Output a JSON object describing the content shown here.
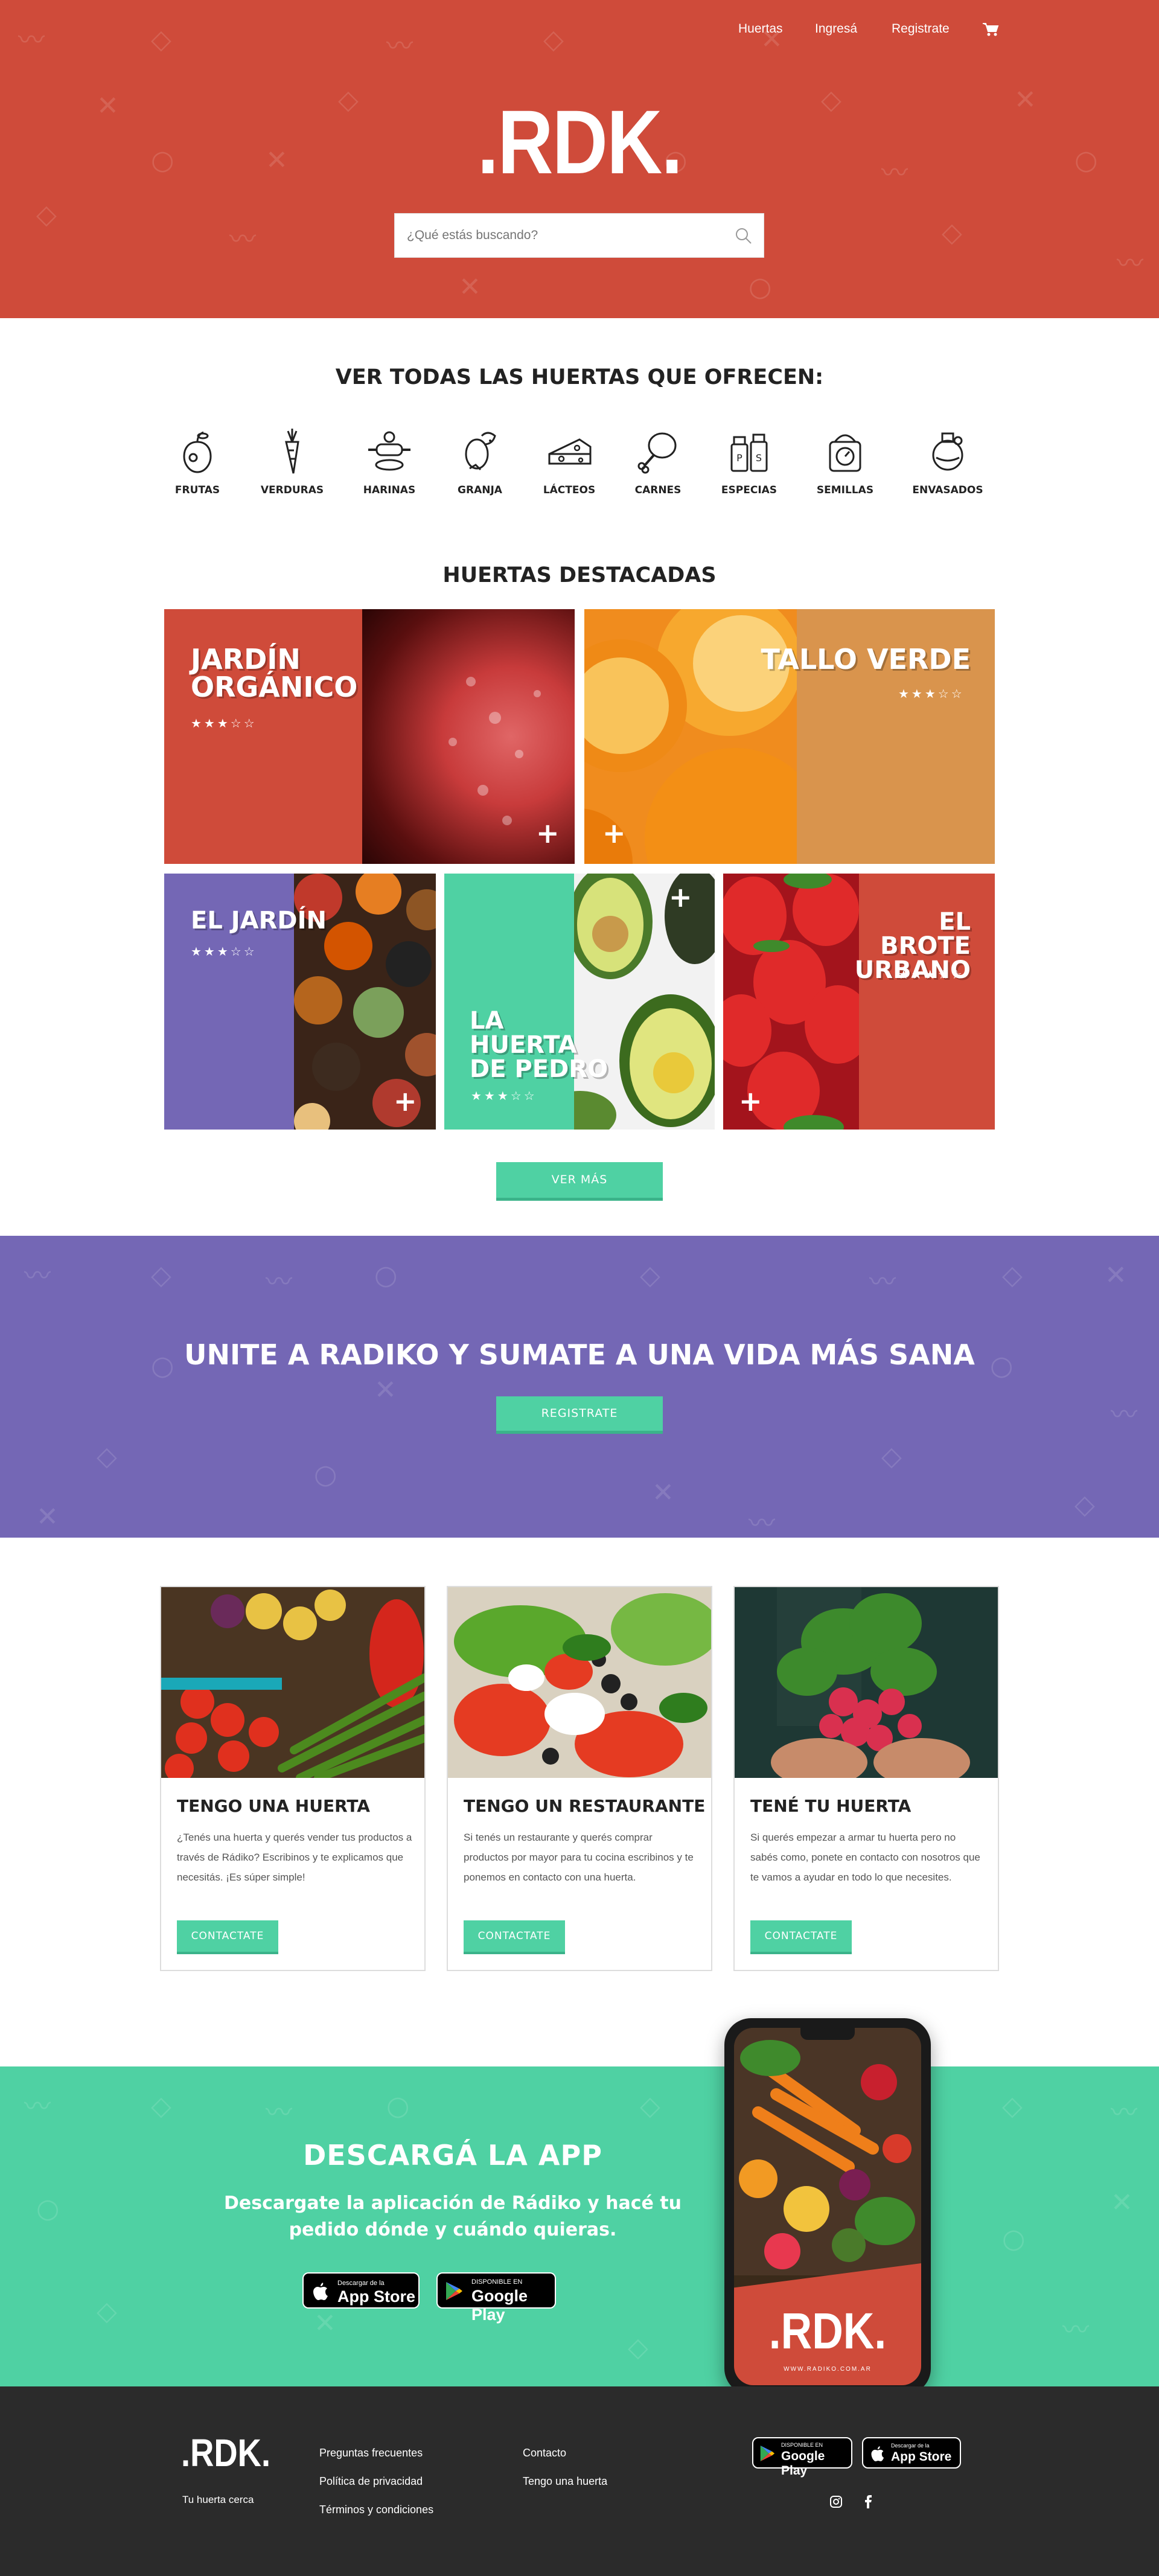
{
  "nav": {
    "huertas": "Huertas",
    "ingresa": "Ingresá",
    "registrate": "Registrate"
  },
  "brand": {
    "logo": ".RDK.",
    "tagline": "Tu huerta cerca",
    "phone_url": "WWW.RADIKO.COM.AR"
  },
  "search": {
    "placeholder": "¿Qué estás buscando?"
  },
  "categories": {
    "title": "VER TODAS LAS HUERTAS QUE OFRECEN:",
    "items": [
      {
        "label": "FRUTAS",
        "icon": "apple-icon"
      },
      {
        "label": "VERDURAS",
        "icon": "carrot-icon"
      },
      {
        "label": "HARINAS",
        "icon": "rolling-pin-icon"
      },
      {
        "label": "GRANJA",
        "icon": "egg-icon"
      },
      {
        "label": "LÁCTEOS",
        "icon": "cheese-icon"
      },
      {
        "label": "CARNES",
        "icon": "chicken-leg-icon"
      },
      {
        "label": "ESPECIAS",
        "icon": "salt-pepper-icon"
      },
      {
        "label": "SEMILLAS",
        "icon": "scale-icon"
      },
      {
        "label": "ENVASADOS",
        "icon": "jar-icon"
      }
    ]
  },
  "featured": {
    "title": "HUERTAS DESTACADAS",
    "tiles": [
      {
        "name": "JARDÍN\nORGÁNICO",
        "stars": "★★★☆☆",
        "color": "#cf4b3a"
      },
      {
        "name": "TALLO VERDE",
        "stars": "★★★☆☆",
        "color": "#d9944d"
      },
      {
        "name": "EL JARDÍN",
        "stars": "★★★☆☆",
        "color": "#7467b5"
      },
      {
        "name": "LA\nHUERTA\nDE PEDRO",
        "stars": "★★★☆☆",
        "color": "#4fd1a3"
      },
      {
        "name": "EL BROTE\nURBANO",
        "stars": "★★★☆☆",
        "color": "#cf4b3a"
      }
    ],
    "more": "VER MÁS"
  },
  "join": {
    "title": "UNITE A RADIKO Y SUMATE A UNA VIDA MÁS SANA",
    "button": "REGISTRATE"
  },
  "cards": [
    {
      "title": "TENGO UNA HUERTA",
      "desc": "¿Tenés una huerta y querés vender tus productos a través de Rádiko? Escribinos y te explicamos que necesitás. ¡Es súper simple!",
      "button": "CONTACTATE"
    },
    {
      "title": "TENGO UN RESTAURANTE",
      "desc": "Si tenés un restaurante y querés comprar productos por mayor para tu cocina escribinos y te ponemos en contacto con una huerta.",
      "button": "CONTACTATE"
    },
    {
      "title": "TENÉ TU HUERTA",
      "desc": "Si querés empezar a armar tu huerta pero no sabés como, ponete en contacto con nosotros que te vamos a ayudar en todo lo que necesites.",
      "button": "CONTACTATE"
    }
  ],
  "app": {
    "title": "DESCARGÁ LA APP",
    "subtitle": "Descargate la aplicación de Rádiko y hacé tu pedido dónde y cuándo quieras.",
    "appstore_small": "Descargar de la",
    "appstore_big": "App Store",
    "play_small": "DISPONIBLE EN",
    "play_big": "Google Play"
  },
  "footer": {
    "col1": [
      "Preguntas frecuentes",
      "Política de privacidad",
      "Términos y condiciones"
    ],
    "col2": [
      "Contacto",
      "Tengo una huerta"
    ]
  },
  "colors": {
    "red": "#cf4b3a",
    "purple": "#7467b5",
    "green": "#4fd1a3",
    "orange": "#d9944d",
    "dark": "#2b2b2b"
  }
}
